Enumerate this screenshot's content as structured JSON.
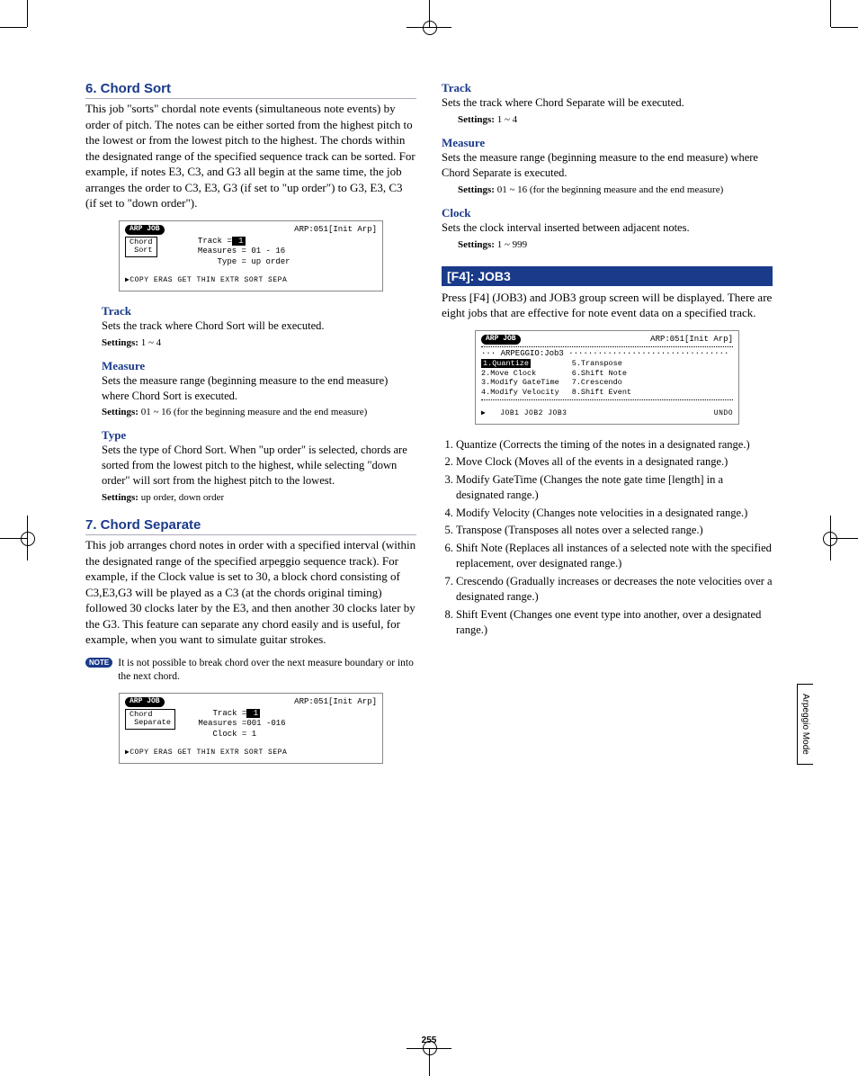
{
  "page_number": "255",
  "side_tab": "Arpeggio Mode",
  "sec6": {
    "title": "6. Chord Sort",
    "body": "This job \"sorts\" chordal note events (simultaneous note events) by order of pitch. The notes can be either sorted from the highest pitch to the lowest or from the lowest pitch to the highest. The chords within the designated range of the specified sequence track can be sorted. For example, if notes E3, C3, and G3 all begin at the same time, the job arranges the order to C3, E3, G3 (if set to \"up order\") to G3, E3, C3 (if set to \"down order\").",
    "lcd": {
      "badge": "ARP JOB",
      "right": "ARP:051[Init Arp]",
      "box1": "Chord",
      "box2": "Sort",
      "track_label": "Track =",
      "track_val": " 1",
      "meas": "Measures = 01  - 16",
      "type": "Type = up order",
      "tabs": "▶COPY ERAS GET THIN EXTR SORT SEPA"
    },
    "track": {
      "title": "Track",
      "body": "Sets the track where Chord Sort will be executed.",
      "settings_label": "Settings:",
      "settings": " 1 ~ 4"
    },
    "measure": {
      "title": "Measure",
      "body": "Sets the measure range (beginning measure to the end measure) where Chord Sort is executed.",
      "settings_label": "Settings:",
      "settings": " 01 ~ 16 (for the beginning measure and the end measure)"
    },
    "type": {
      "title": "Type",
      "body": "Sets the type of Chord Sort. When \"up order\" is selected, chords are sorted from the lowest pitch to the highest, while selecting \"down order\" will sort from the highest pitch to the lowest.",
      "settings_label": "Settings:",
      "settings": " up order, down order"
    }
  },
  "sec7": {
    "title": "7. Chord Separate",
    "body": "This job arranges chord notes in order with a specified interval (within the designated range of the specified arpeggio sequence track). For example, if the Clock value is set to 30, a block chord consisting of C3,E3,G3 will be played as a C3 (at the chords original timing) followed 30 clocks later by the E3, and then another 30 clocks later by the G3. This feature can separate any chord easily and is useful, for example, when you want to simulate guitar strokes.",
    "note_label": "NOTE",
    "note": "It is not possible to break chord over the next measure boundary or into the next chord.",
    "lcd": {
      "badge": "ARP JOB",
      "right": "ARP:051[Init Arp]",
      "box1": "Chord",
      "box2": "Separate",
      "track_label": "Track =",
      "track_val": " 1",
      "meas": "Measures =001  -016",
      "clock": "Clock =   1",
      "tabs": "▶COPY ERAS GET THIN EXTR SORT SEPA"
    },
    "track": {
      "title": "Track",
      "body": "Sets the track where Chord Separate will be executed.",
      "settings_label": "Settings:",
      "settings": " 1 ~ 4"
    },
    "measure": {
      "title": "Measure",
      "body": "Sets the measure range (beginning measure to the end measure) where Chord Separate is executed.",
      "settings_label": "Settings:",
      "settings": " 01 ~ 16 (for the beginning measure and the end measure)"
    },
    "clock": {
      "title": "Clock",
      "body": "Sets the clock interval inserted between adjacent notes.",
      "settings_label": "Settings:",
      "settings": " 1 ~ 999"
    }
  },
  "f4": {
    "header": "[F4]: JOB3",
    "body": "Press [F4] (JOB3) and JOB3 group screen will be displayed. There are eight jobs that are effective for note event data on a specified track.",
    "lcd": {
      "badge": "ARP JOB",
      "right": "ARP:051[Init Arp]",
      "subtitle": "ARPEGGIO:Job3",
      "left1": "1.Quantize",
      "left2": "2.Move Clock",
      "left3": "3.Modify GateTime",
      "left4": "4.Modify Velocity",
      "right1": "5.Transpose",
      "right2": "6.Shift Note",
      "right3": "7.Crescendo",
      "right4": "8.Shift Event",
      "tabs_left": "JOB1 JOB2 JOB3",
      "tabs_right": "UNDO"
    },
    "items": [
      "Quantize (Corrects the timing of the notes in a designated range.)",
      "Move Clock (Moves all of the events in a designated range.)",
      "Modify GateTime (Changes the note gate time [length] in a designated range.)",
      "Modify Velocity (Changes note velocities in a designated range.)",
      "Transpose (Transposes all notes over a selected range.)",
      "Shift Note (Replaces all instances of a selected note with the specified replacement, over designated range.)",
      "Crescendo (Gradually increases or decreases the note velocities over a designated range.)",
      "Shift Event (Changes one event type into another, over a designated range.)"
    ]
  }
}
